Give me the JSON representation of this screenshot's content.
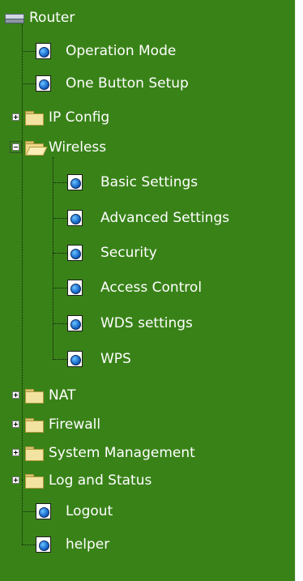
{
  "tree": {
    "root": {
      "label": "Router",
      "icon": "router-icon"
    },
    "items": [
      {
        "label": "Operation Mode",
        "icon": "page-globe-icon"
      },
      {
        "label": "One Button Setup",
        "icon": "page-globe-icon"
      },
      {
        "label": "IP Config",
        "icon": "folder-icon",
        "expanded": false
      },
      {
        "label": "Wireless",
        "icon": "folder-open-icon",
        "expanded": true,
        "children": [
          {
            "label": "Basic Settings"
          },
          {
            "label": "Advanced Settings"
          },
          {
            "label": "Security"
          },
          {
            "label": "Access Control"
          },
          {
            "label": "WDS settings"
          },
          {
            "label": "WPS"
          }
        ]
      },
      {
        "label": "NAT",
        "icon": "folder-icon",
        "expanded": false
      },
      {
        "label": "Firewall",
        "icon": "folder-icon",
        "expanded": false
      },
      {
        "label": "System Management",
        "icon": "folder-icon",
        "expanded": false
      },
      {
        "label": "Log and Status",
        "icon": "folder-icon",
        "expanded": false
      },
      {
        "label": "Logout",
        "icon": "page-globe-icon"
      },
      {
        "label": "helper",
        "icon": "page-globe-icon"
      }
    ]
  },
  "colors": {
    "background": "#398218",
    "text": "#ffffff"
  }
}
